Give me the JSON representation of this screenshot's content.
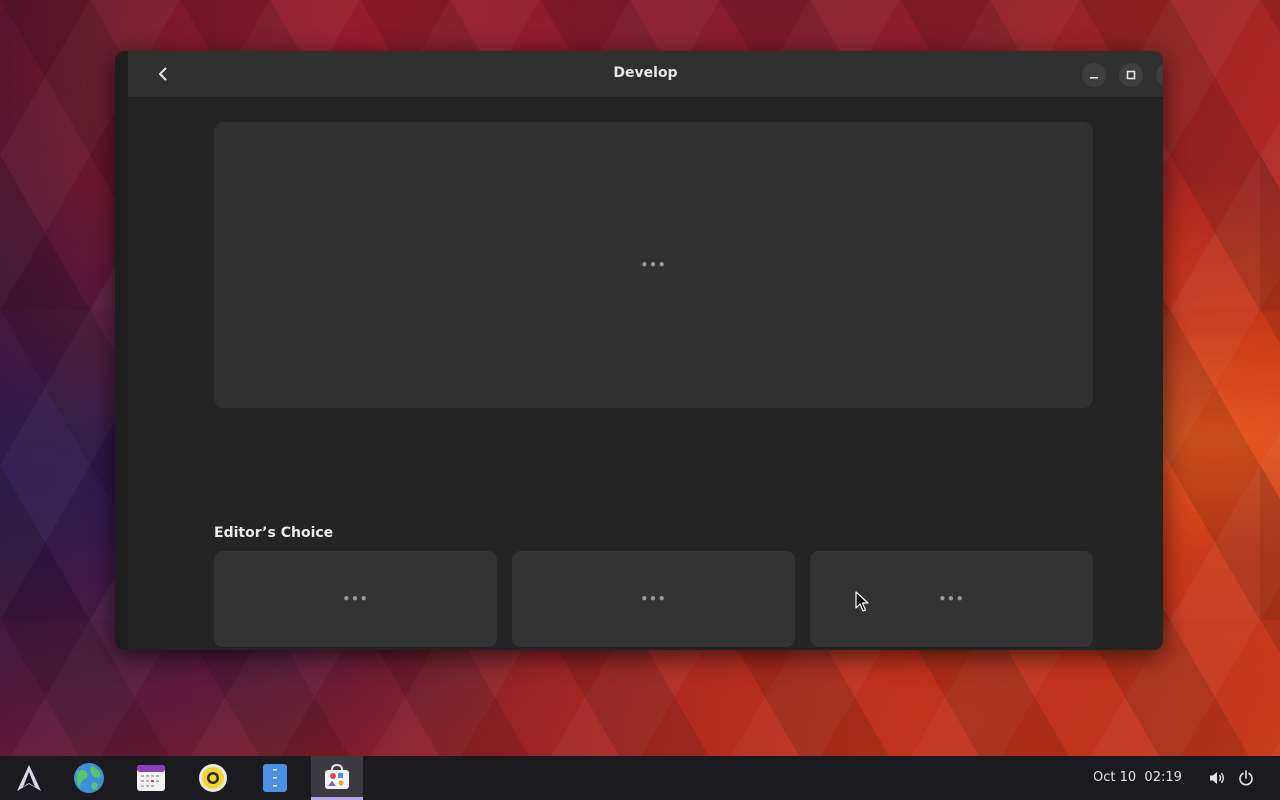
{
  "window": {
    "title": "Develop",
    "banner_loading": "•••",
    "section_title": "Editor’s Choice",
    "tiles": [
      {
        "loading": "•••"
      },
      {
        "loading": "•••"
      },
      {
        "loading": "•••"
      },
      {
        "loading": ""
      },
      {
        "loading": ""
      },
      {
        "loading": ""
      }
    ]
  },
  "taskbar": {
    "apps": [
      {
        "name": "launcher-icon"
      },
      {
        "name": "web-browser-icon"
      },
      {
        "name": "calendar-icon"
      },
      {
        "name": "music-player-icon"
      },
      {
        "name": "file-manager-icon"
      },
      {
        "name": "software-store-icon",
        "active": true
      }
    ],
    "clock_date": "Oct 10",
    "clock_time": "02:19",
    "tray": [
      "volume-icon",
      "power-icon"
    ]
  },
  "colors": {
    "window_bg": "#242424",
    "headerbar_bg": "#303030",
    "tile_bg": "#333333",
    "taskbar_bg": "#1b1b1f",
    "active_indicator": "#b9a6e8"
  }
}
